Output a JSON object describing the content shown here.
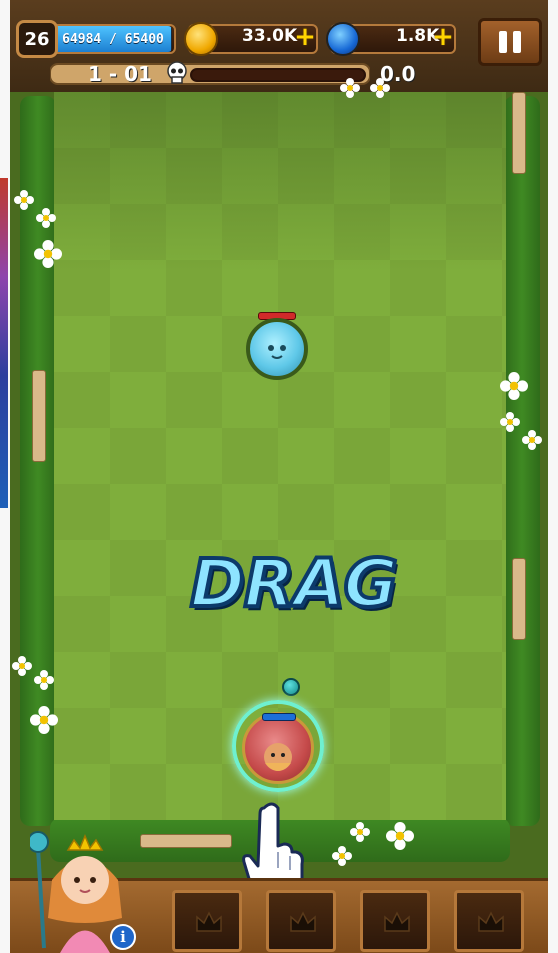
{
  "hud": {
    "player_level": "26",
    "xp_text": "64984 / 65400",
    "xp_fraction": 0.994,
    "coins": "33.0K",
    "gems": "1.8K",
    "plus_symbol": "+"
  },
  "stage": {
    "label": "1 - 01",
    "score": "0.0",
    "boss_progress_fraction": 0.0
  },
  "arena": {
    "instruction": "DRAG",
    "enemy_hp_fraction": 1.0,
    "hero_hp_fraction": 1.0
  },
  "bottom": {
    "info_label": "i",
    "slot_icon": "crown-icon"
  },
  "colors": {
    "grass": "#7fae3c",
    "hud_wood": "#5a3d1e",
    "drag_text": "#8ee4ff",
    "hero_ring": "#6ff0d0"
  }
}
